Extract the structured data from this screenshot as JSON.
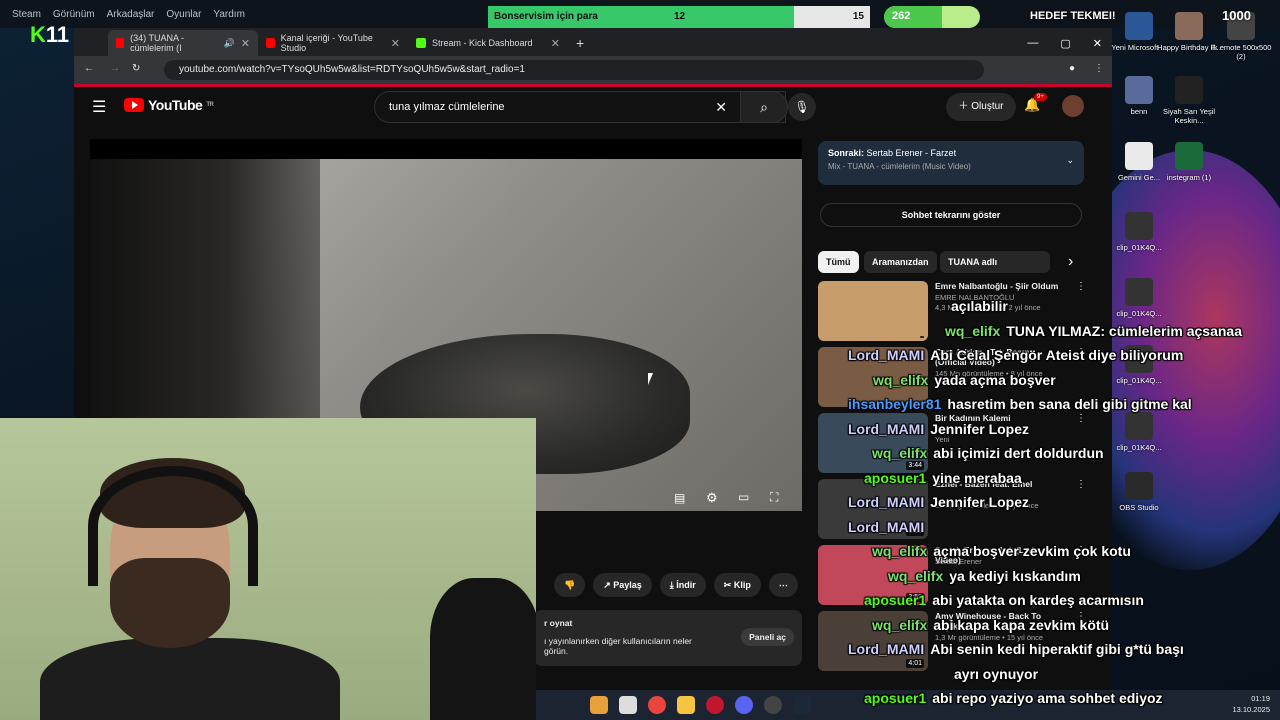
{
  "steam": {
    "menu": [
      "Steam",
      "Görünüm",
      "Arkadaşlar",
      "Oyunlar",
      "Yardım"
    ],
    "kick_count": "11"
  },
  "goal": {
    "label": "Bonservisim için para",
    "current": "12",
    "target": "15",
    "progress": 0.8
  },
  "overlay": {
    "count_262": "262",
    "pill_progress": 0.6,
    "hedef": "HEDEF TEKMEI!",
    "count_1000": "1000"
  },
  "browser": {
    "tabs": [
      {
        "label": "(34) TUANA - cümlelerim (I",
        "active": true,
        "color": "#ff0000"
      },
      {
        "label": "Kanal içeriği - YouTube Studio",
        "active": false,
        "color": "#ff0000"
      },
      {
        "label": "Stream - Kick Dashboard",
        "active": false,
        "color": "#53fc18"
      }
    ],
    "url": "youtube.com/watch?v=TYsoQUh5w5w&list=RDTYsoQUh5w5w&start_radio=1"
  },
  "youtube": {
    "logo": "YouTube",
    "region": "TR",
    "search_value": "tuna yılmaz cümlelerine",
    "create_label": "Oluştur",
    "notif_badge": "9+",
    "next_up_label": "Sonraki:",
    "next_up_title": "Sertab Erener - Farzet",
    "next_up_sub": "Mix - TUANA - cümlelerim (Music Video)",
    "chat_button": "Sohbet tekrarını göster",
    "chips": [
      "Tümü",
      "Aramanızdan",
      "TUANA adlı yükleyiciden"
    ],
    "videos": [
      {
        "title": "Emre Nalbantoğlu - Şiir Oldum",
        "channel": "EMRE NALBANTOĞLU",
        "meta": "4,3 Mn görüntüleme • 2 yıl önce",
        "duration": "",
        "thumb": "#c79d6b"
      },
      {
        "title": "Cem Adrian - Tek Başına (Official Video)",
        "channel": "",
        "meta": "145 Mn görüntüleme • 8 yıl önce",
        "duration": "",
        "thumb": "#7a5b44"
      },
      {
        "title": "Bir Kadının Kalemi",
        "channel": "ZOR",
        "meta": "Yeni",
        "duration": "3:44",
        "thumb": "#394b5a"
      },
      {
        "title": "Ezhel - Bazen feat. Emel",
        "channel": "",
        "meta": "25 Mn görüntüleme • 6 yıl önce",
        "duration": "3:53",
        "thumb": "#3a3a3a"
      },
      {
        "title": "Sertab Erener - Aşk (Lyric Video)",
        "channel": "Sertab Erener",
        "meta": "",
        "duration": "3:58",
        "thumb": "#c0485a"
      },
      {
        "title": "Amy Winehouse - Back To Black",
        "channel": "Amy Winehouse",
        "meta": "1,3 Mr görüntüleme • 15 yıl önce",
        "duration": "4:01",
        "thumb": "#4a4038"
      }
    ],
    "actions": [
      "Paylaş",
      "İndir",
      "Klip"
    ],
    "live_text_1": "r oynat",
    "live_text_2": "ı yayınlanırken diğer kullanıcıların neler",
    "live_text_3": "görün.",
    "live_button": "Paneli aç"
  },
  "chat": [
    {
      "user": "",
      "msg": "açılabilir",
      "user_color": "#ffffff"
    },
    {
      "user": "wq_elifx",
      "msg": "TUNA YILMAZ: cümlelerim açsanaa",
      "user_color": "#7be36b"
    },
    {
      "user": "Lord_MAMI",
      "msg": "Abi Celal Şengör Ateist diye biliyorum",
      "user_color": "#cfcfff"
    },
    {
      "user": "wq_elifx",
      "msg": "yada açma boşver",
      "user_color": "#7be36b"
    },
    {
      "user": "ihsanbeyler81",
      "msg": "hasretim ben sana deli gibi gitme kal",
      "user_color": "#4a9cff"
    },
    {
      "user": "Lord_MAMI",
      "msg": "Jennifer Lopez",
      "user_color": "#cfcfff"
    },
    {
      "user": "wq_elifx",
      "msg": "abi içimizi dert doldurdun",
      "user_color": "#7be36b"
    },
    {
      "user": "aposuer1",
      "msg": "yine merabaa",
      "user_color": "#53fc18"
    },
    {
      "user": "Lord_MAMI",
      "msg": "Jennifer Lopez",
      "user_color": "#cfcfff"
    },
    {
      "user": "Lord_MAMI",
      "msg": "",
      "user_color": "#cfcfff"
    },
    {
      "user": "wq_elifx",
      "msg": "açma boşver zevkim çok kotu",
      "user_color": "#7be36b"
    },
    {
      "user": "wq_elifx",
      "msg": "ya kediyi kıskandım",
      "user_color": "#7be36b"
    },
    {
      "user": "aposuer1",
      "msg": "abi yatakta on kardeş acarmısın",
      "user_color": "#53fc18"
    },
    {
      "user": "wq_elifx",
      "msg": "abi kapa kapa zevkim kötü",
      "user_color": "#7be36b"
    },
    {
      "user": "Lord_MAMI",
      "msg": "Abi senin kedi hiperaktif gibi g*tü başı",
      "user_color": "#cfcfff"
    },
    {
      "user": "",
      "msg": "ayrı oynuyor",
      "user_color": "#ffffff"
    },
    {
      "user": "aposuer1",
      "msg": "abi repo yaziyo ama sohbet ediyoz",
      "user_color": "#53fc18"
    }
  ],
  "desktop_icons": [
    {
      "label": "Yeni Microsoft ...",
      "color": "#2b5797"
    },
    {
      "label": "Happy Birthday P...",
      "color": "#8a6a5a"
    },
    {
      "label": "ilk emote 500x500 (2)",
      "color": "#444"
    },
    {
      "label": "benn",
      "color": "#5a6a9a"
    },
    {
      "label": "Siyah Sarı Yeşil Keskin...",
      "color": "#222"
    },
    {
      "label": "Gemini Ge...",
      "color": "#eaeaea"
    },
    {
      "label": "instegram (1)",
      "color": "#1a6a3a"
    },
    {
      "label": "clip_01K4Q...",
      "color": "#333"
    },
    {
      "label": "clip_01K4Q...",
      "color": "#333"
    },
    {
      "label": "clip_01K4Q...",
      "color": "#333"
    },
    {
      "label": "clip_01K4Q...",
      "color": "#333"
    },
    {
      "label": "OBS Studio",
      "color": "#2a2a2a"
    }
  ],
  "taskbar": {
    "time": "01:19",
    "date": "13.10.2025"
  }
}
